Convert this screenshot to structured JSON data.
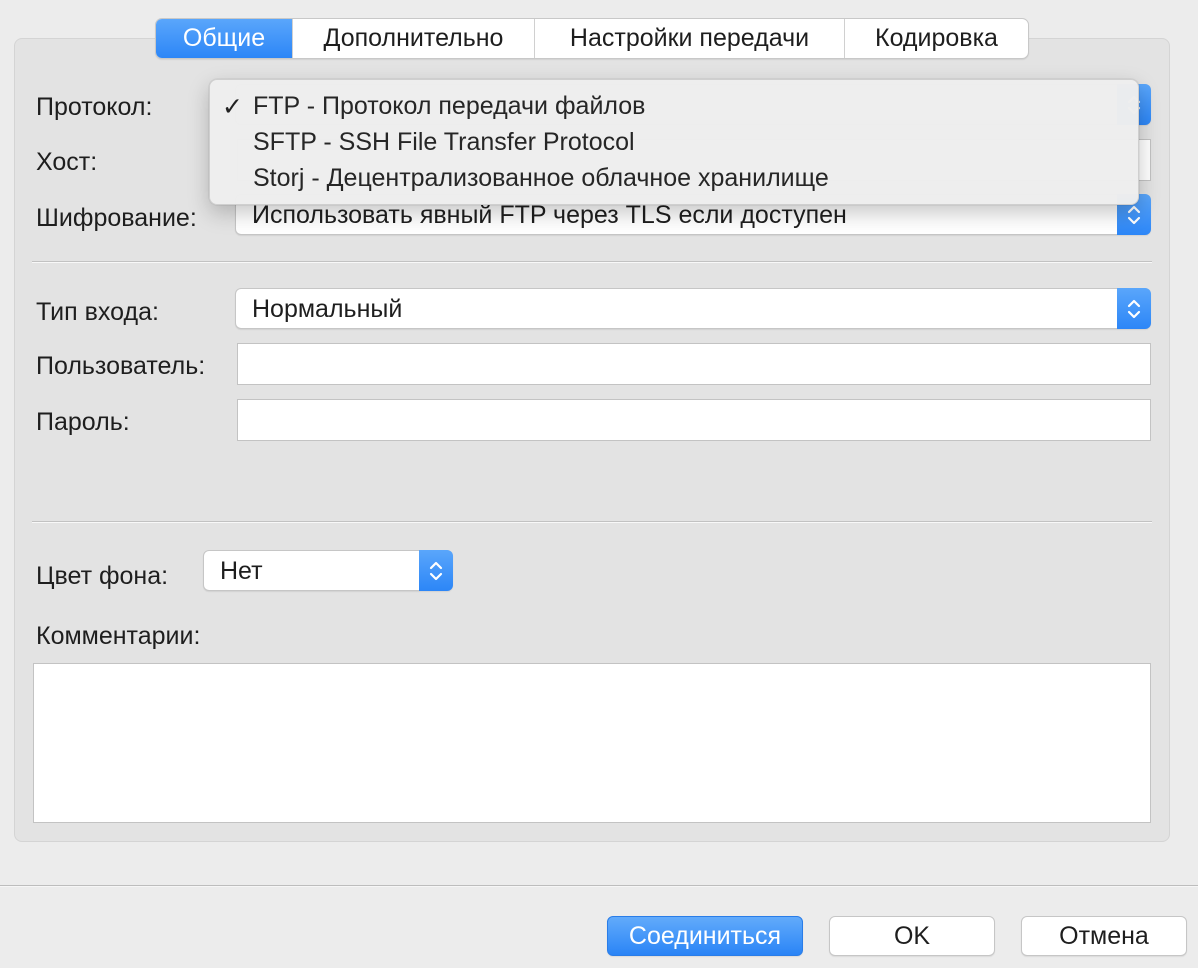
{
  "tabs": [
    {
      "label": "Общие",
      "active": true
    },
    {
      "label": "Дополнительно",
      "active": false
    },
    {
      "label": "Настройки передачи",
      "active": false
    },
    {
      "label": "Кодировка",
      "active": false
    }
  ],
  "form": {
    "protocol_label": "Протокол:",
    "host_label": "Хост:",
    "encryption_label": "Шифрование:",
    "encryption_value": "Использовать явный FTP через TLS если доступен",
    "logon_type_label": "Тип входа:",
    "logon_type_value": "Нормальный",
    "user_label": "Пользователь:",
    "user_value": "",
    "password_label": "Пароль:",
    "password_value": "",
    "bg_color_label": "Цвет фона:",
    "bg_color_value": "Нет",
    "comments_label": "Комментарии:",
    "comments_value": ""
  },
  "protocol_menu": {
    "check_glyph": "✓",
    "items": [
      {
        "label": "FTP - Протокол передачи файлов",
        "selected": true
      },
      {
        "label": "SFTP - SSH File Transfer Protocol",
        "selected": false
      },
      {
        "label": "Storj - Децентрализованное облачное хранилище",
        "selected": false
      }
    ]
  },
  "buttons": {
    "connect": "Соединиться",
    "ok": "OK",
    "cancel": "Отмена"
  },
  "colors": {
    "accent": "#2c86f7",
    "window_bg": "#ececec",
    "panel_bg": "#e3e3e3"
  }
}
